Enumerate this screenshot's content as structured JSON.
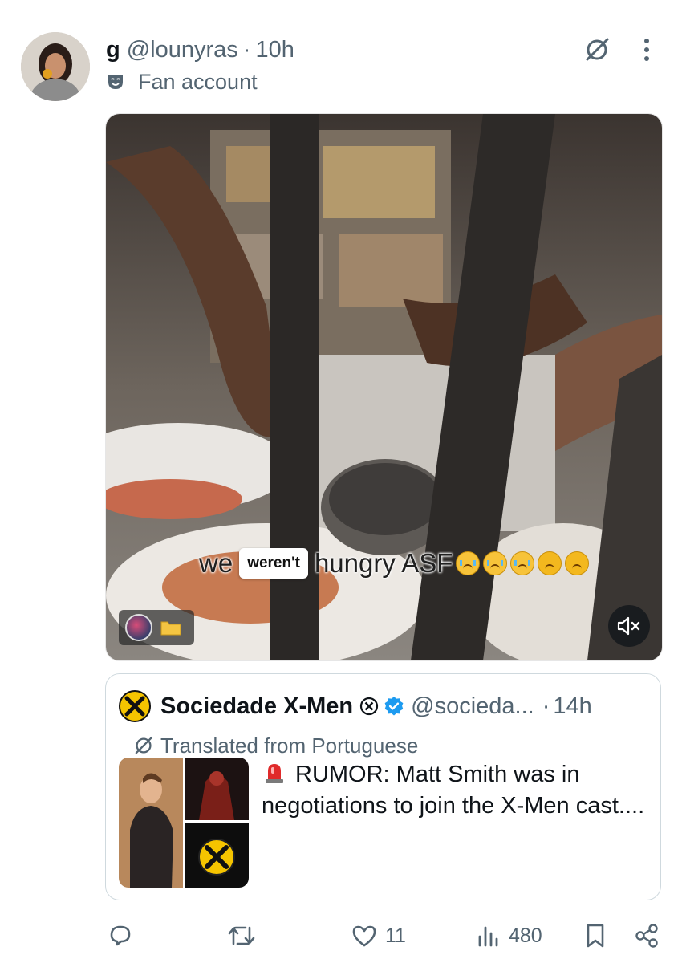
{
  "tweet": {
    "display_name": "g",
    "handle": "@lounyras",
    "separator": "·",
    "time": "10h",
    "label": "Fan account"
  },
  "media": {
    "caption_start": "we",
    "caption_pill": "weren't",
    "caption_end": "hungry ASF"
  },
  "quote": {
    "name": "Sociedade X-Men",
    "handle": "@socieda...",
    "separator": "·",
    "time": "14h",
    "translated": "Translated from Portuguese",
    "text": "RUMOR: Matt Smith was in negotiations to join the X-Men cast...."
  },
  "actions": {
    "reply_count": "",
    "retweet_count": "",
    "like_count": "11",
    "views_count": "480"
  },
  "colors": {
    "text": "#0f1419",
    "secondary": "#536471",
    "verified": "#1d9bf0",
    "xmen_yellow": "#f5c400"
  },
  "icons": [
    "fan-mask-icon",
    "grok-icon",
    "more-icon",
    "mute-icon",
    "verified-icon",
    "translate-icon",
    "siren-icon",
    "reply-icon",
    "retweet-icon",
    "like-icon",
    "views-icon",
    "bookmark-icon",
    "share-icon"
  ]
}
